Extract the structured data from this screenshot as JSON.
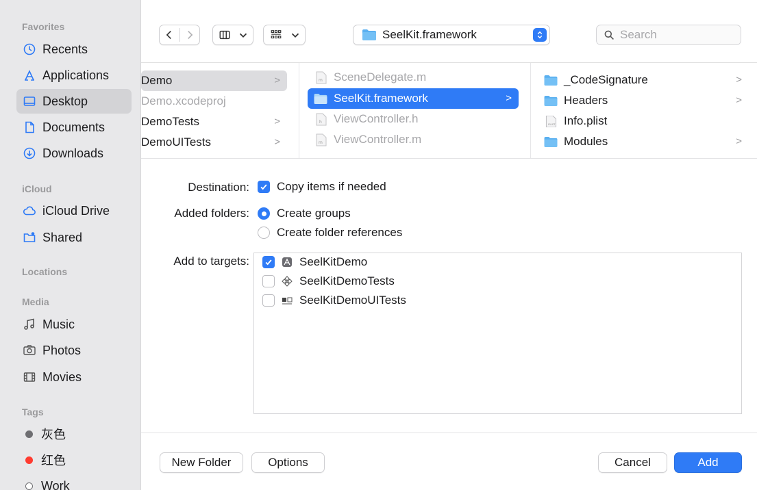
{
  "sidebar": {
    "favorites_header": "Favorites",
    "favorites": [
      {
        "label": "Recents",
        "icon": "clock-icon"
      },
      {
        "label": "Applications",
        "icon": "applications-icon"
      },
      {
        "label": "Desktop",
        "icon": "desktop-icon",
        "selected": true
      },
      {
        "label": "Documents",
        "icon": "document-icon"
      },
      {
        "label": "Downloads",
        "icon": "download-icon"
      }
    ],
    "icloud_header": "iCloud",
    "icloud": [
      {
        "label": "iCloud Drive",
        "icon": "cloud-icon"
      },
      {
        "label": "Shared",
        "icon": "shared-folder-icon"
      }
    ],
    "locations_header": "Locations",
    "media_header": "Media",
    "media": [
      {
        "label": "Music",
        "icon": "music-icon"
      },
      {
        "label": "Photos",
        "icon": "camera-icon"
      },
      {
        "label": "Movies",
        "icon": "film-icon"
      }
    ],
    "tags_header": "Tags",
    "tags": [
      {
        "label": "灰色",
        "color": "#8e8e93"
      },
      {
        "label": "红色",
        "color": "#ff3b30"
      },
      {
        "label": "Work",
        "color": "#ffffff"
      }
    ]
  },
  "toolbar": {
    "location": "SeelKit.framework",
    "search_placeholder": "Search"
  },
  "browser": {
    "col1": [
      {
        "label": "Demo",
        "selected": true,
        "chevron": ">"
      },
      {
        "label": "Demo.xcodeproj",
        "dim": true
      },
      {
        "label": "DemoTests",
        "chevron": ">"
      },
      {
        "label": "DemoUITests",
        "chevron": ">"
      }
    ],
    "col2": [
      {
        "label": "SceneDelegate.m",
        "dim": true,
        "ext": "m"
      },
      {
        "label": "SeelKit.framework",
        "selected": true,
        "chevron": ">"
      },
      {
        "label": "ViewController.h",
        "dim": true,
        "ext": "h"
      },
      {
        "label": "ViewController.m",
        "dim": true,
        "ext": "m"
      }
    ],
    "col3": [
      {
        "label": "_CodeSignature",
        "chevron": ">"
      },
      {
        "label": "Headers",
        "chevron": ">"
      },
      {
        "label": "Info.plist"
      },
      {
        "label": "Modules",
        "chevron": ">"
      }
    ]
  },
  "options": {
    "destination_label": "Destination:",
    "copy_items": "Copy items if needed",
    "added_folders_label": "Added folders:",
    "create_groups": "Create groups",
    "create_folder_refs": "Create folder references",
    "add_to_targets_label": "Add to targets:",
    "targets": [
      {
        "label": "SeelKitDemo",
        "checked": true,
        "icon": "app-target-icon"
      },
      {
        "label": "SeelKitDemoTests",
        "checked": false,
        "icon": "test-target-icon"
      },
      {
        "label": "SeelKitDemoUITests",
        "checked": false,
        "icon": "ui-test-target-icon"
      }
    ]
  },
  "footer": {
    "new_folder": "New Folder",
    "options": "Options",
    "cancel": "Cancel",
    "add": "Add"
  },
  "colors": {
    "accent": "#2f7bf6",
    "sidebar_bg": "#e8e8ea"
  }
}
